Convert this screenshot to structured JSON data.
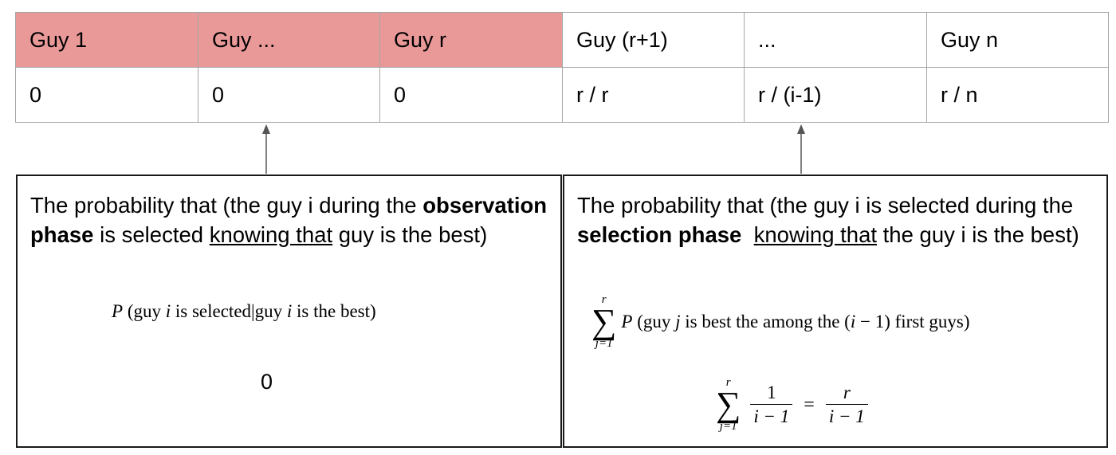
{
  "table": {
    "headers": [
      "Guy 1",
      "Guy ...",
      "Guy r",
      "Guy (r+1)",
      "...",
      "Guy n"
    ],
    "values": [
      "0",
      "0",
      "0",
      "r / r",
      "r / (i-1)",
      "r / n"
    ]
  },
  "colors": {
    "observation_phase": "#ea9999",
    "border": "#a6a6a6"
  },
  "left_box": {
    "text_pre": "The probability that (the guy i during the ",
    "text_bold": "observation phase",
    "text_mid": " is selected ",
    "text_underline": "knowing that",
    "text_post": " guy is the best)",
    "formula": "P (guy i is selected|guy i is the best)",
    "result": "0"
  },
  "right_box": {
    "text_pre": "The probability that (the guy i is selected during the ",
    "text_bold": "selection phase",
    "text_mid": "  ",
    "text_underline": "knowing that",
    "text_post": " the guy i is the best)",
    "formula1": {
      "sum_top": "r",
      "sum_bottom": "j=1",
      "expression": "P (guy j is best the among the (i − 1) first guys)"
    },
    "formula2": {
      "sum_top": "r",
      "sum_bottom": "j=1",
      "frac1_num": "1",
      "frac1_den": "i − 1",
      "equals": "=",
      "frac2_num": "r",
      "frac2_den": "i − 1"
    }
  }
}
